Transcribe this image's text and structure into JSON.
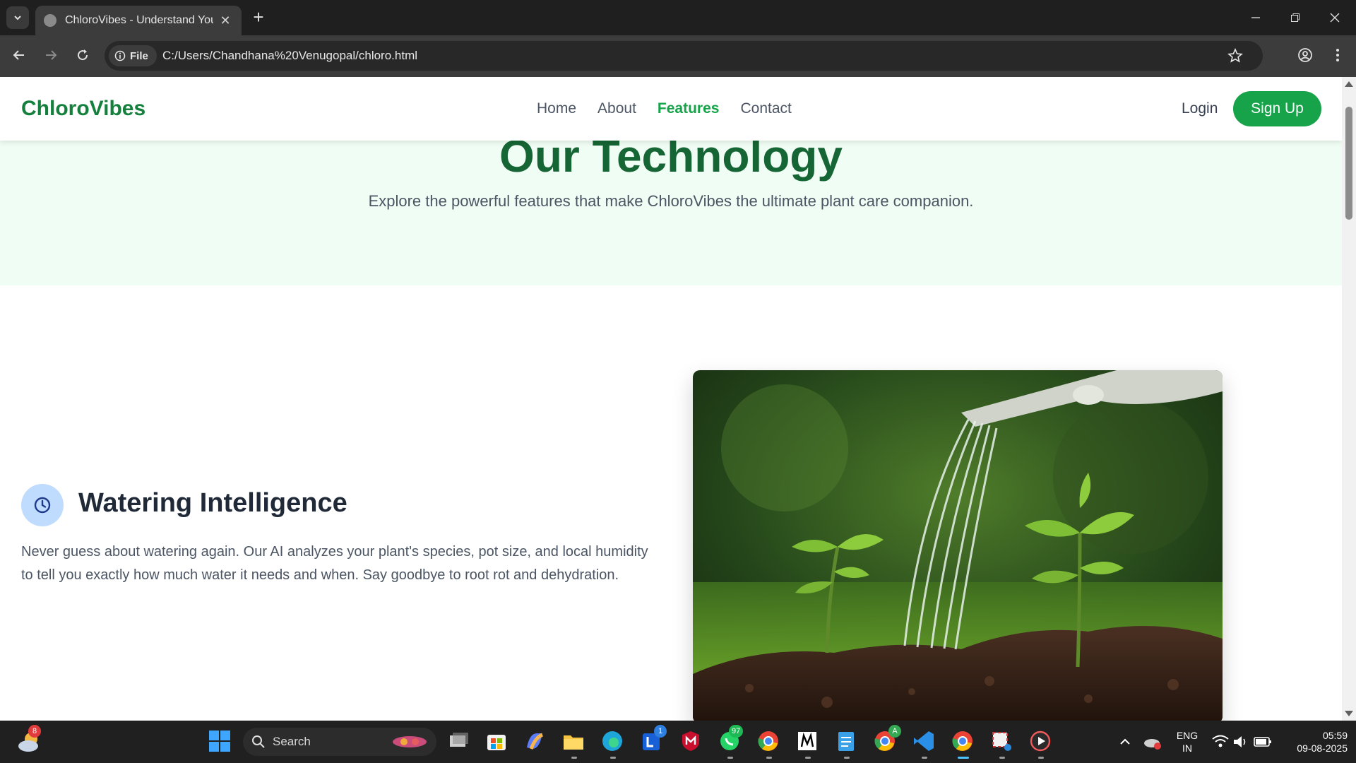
{
  "browser": {
    "tab_title": "ChloroVibes - Understand Your",
    "address_chip": "File",
    "url": "C:/Users/Chandhana%20Venugopal/chloro.html"
  },
  "site": {
    "brand": "ChloroVibes",
    "nav": [
      {
        "label": "Home",
        "active": false
      },
      {
        "label": "About",
        "active": false
      },
      {
        "label": "Features",
        "active": true
      },
      {
        "label": "Contact",
        "active": false
      }
    ],
    "login_label": "Login",
    "signup_label": "Sign Up"
  },
  "hero": {
    "title": "Our Technology",
    "subtitle": "Explore the powerful features that make ChloroVibes the ultimate plant care companion."
  },
  "feature": {
    "icon": "clock-icon",
    "title": "Watering Intelligence",
    "description": "Never guess about watering again. Our AI analyzes your plant's species, pot size, and local humidity to tell you exactly how much water it needs and when. Say goodbye to root rot and dehydration.",
    "image": "watering-can-seedlings-photo"
  },
  "taskbar": {
    "weather_badge": "8",
    "search_label": "Search",
    "outlook_badge": "1",
    "whatsapp_badge": "97",
    "chrome_profile_badge": "A",
    "language": "ENG",
    "region": "IN",
    "time": "05:59",
    "date": "09-08-2025"
  },
  "colors": {
    "brand_green": "#15803d",
    "accent_green": "#16a34a",
    "hero_bg": "#f0fdf4",
    "icon_bg": "#bfdbfe"
  }
}
